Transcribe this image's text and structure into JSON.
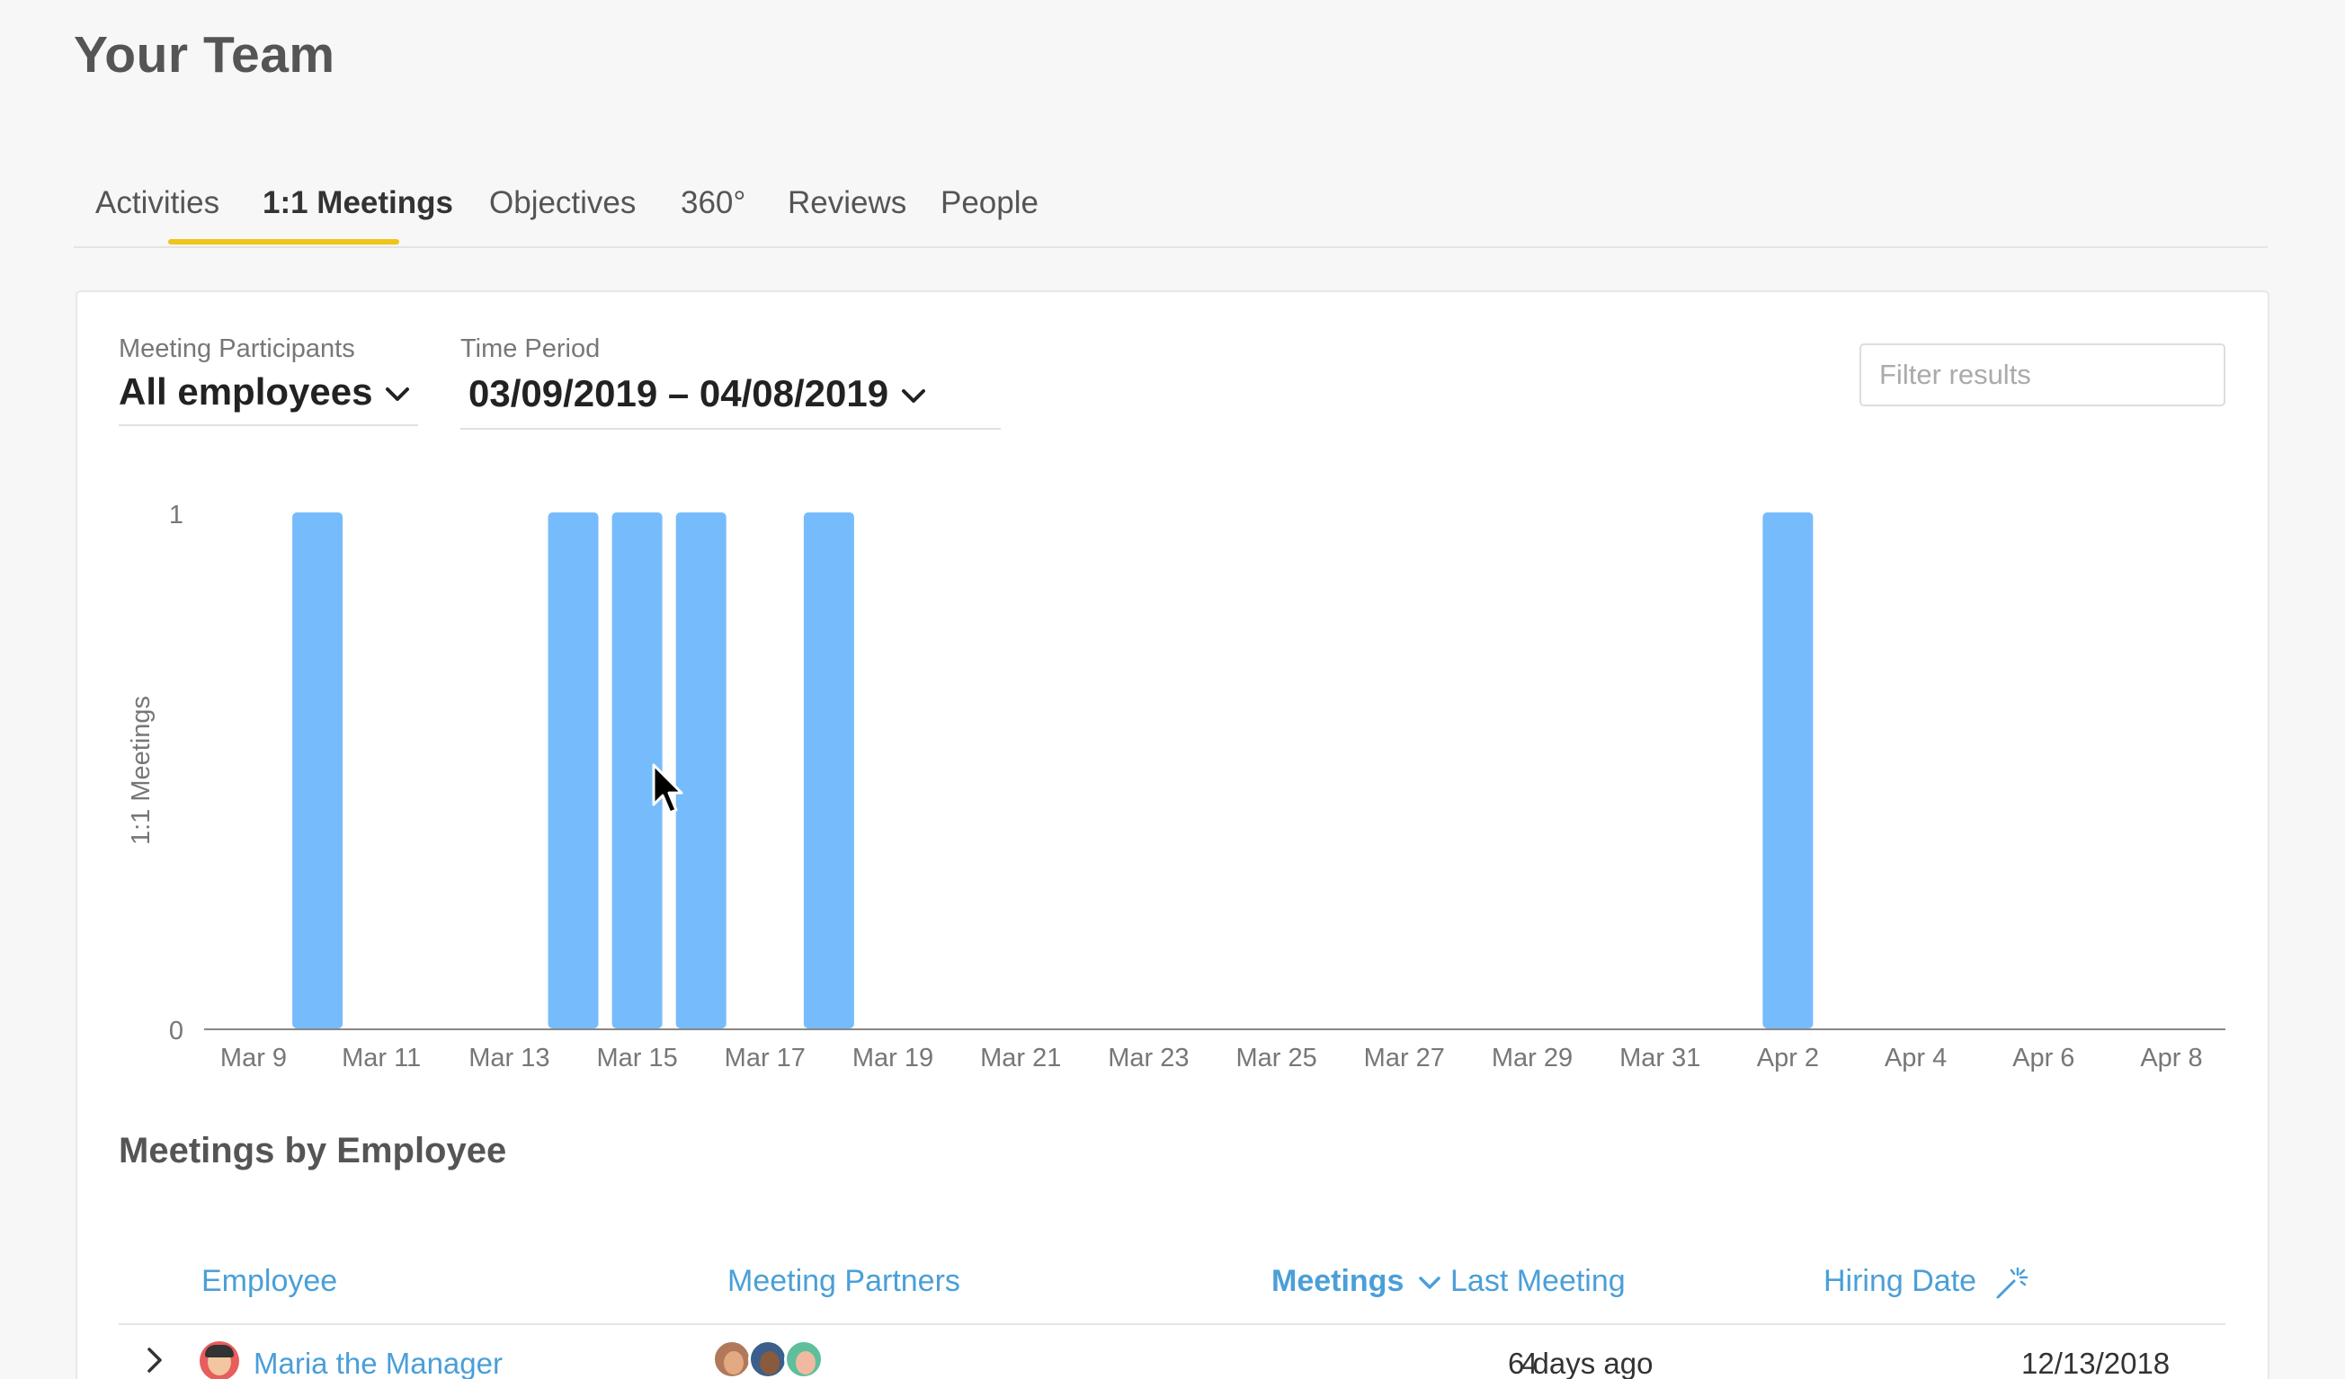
{
  "page": {
    "title": "Your Team"
  },
  "tabs": [
    {
      "label": "Activities",
      "active": false
    },
    {
      "label": "1:1 Meetings",
      "active": true
    },
    {
      "label": "Objectives",
      "active": false
    },
    {
      "label": "360°",
      "active": false
    },
    {
      "label": "Reviews",
      "active": false
    },
    {
      "label": "People",
      "active": false
    }
  ],
  "filters": {
    "participants": {
      "label": "Meeting Participants",
      "value": "All employees"
    },
    "period": {
      "label": "Time Period",
      "value": "03/09/2019 – 04/08/2019"
    },
    "search": {
      "placeholder": "Filter results",
      "value": ""
    }
  },
  "chart_data": {
    "type": "bar",
    "ylabel": "1:1 Meetings",
    "xlabel": "",
    "ylim": [
      0,
      1
    ],
    "yticks": [
      "0",
      "1"
    ],
    "xticks": [
      "Mar 9",
      "Mar 11",
      "Mar 13",
      "Mar 15",
      "Mar 17",
      "Mar 19",
      "Mar 21",
      "Mar 23",
      "Mar 25",
      "Mar 27",
      "Mar 29",
      "Mar 31",
      "Apr 2",
      "Apr 4",
      "Apr 6",
      "Apr 8"
    ],
    "categories": [
      "Mar 9",
      "Mar 10",
      "Mar 11",
      "Mar 12",
      "Mar 13",
      "Mar 14",
      "Mar 15",
      "Mar 16",
      "Mar 17",
      "Mar 18",
      "Mar 19",
      "Mar 20",
      "Mar 21",
      "Mar 22",
      "Mar 23",
      "Mar 24",
      "Mar 25",
      "Mar 26",
      "Mar 27",
      "Mar 28",
      "Mar 29",
      "Mar 30",
      "Mar 31",
      "Apr 1",
      "Apr 2",
      "Apr 3",
      "Apr 4",
      "Apr 5",
      "Apr 6",
      "Apr 7",
      "Apr 8"
    ],
    "values": [
      0,
      1,
      0,
      0,
      0,
      1,
      1,
      1,
      0,
      1,
      0,
      0,
      0,
      0,
      0,
      0,
      0,
      0,
      0,
      0,
      0,
      0,
      0,
      0,
      1,
      0,
      0,
      0,
      0,
      0,
      0
    ],
    "bar_color": "#76bcfc",
    "grid": false
  },
  "table": {
    "title": "Meetings by Employee",
    "headers": {
      "employee": "Employee",
      "partners": "Meeting Partners",
      "meetings": "Meetings",
      "last": "Last Meeting",
      "hiring": "Hiring Date"
    },
    "rows": [
      {
        "employee": "Maria the Manager",
        "meetings": "4",
        "last": "6 days ago",
        "hiring": "12/13/2018"
      }
    ]
  },
  "colors": {
    "accent": "#4a9fd8",
    "tab_underline": "#f0c419",
    "bar": "#76bcfc"
  }
}
